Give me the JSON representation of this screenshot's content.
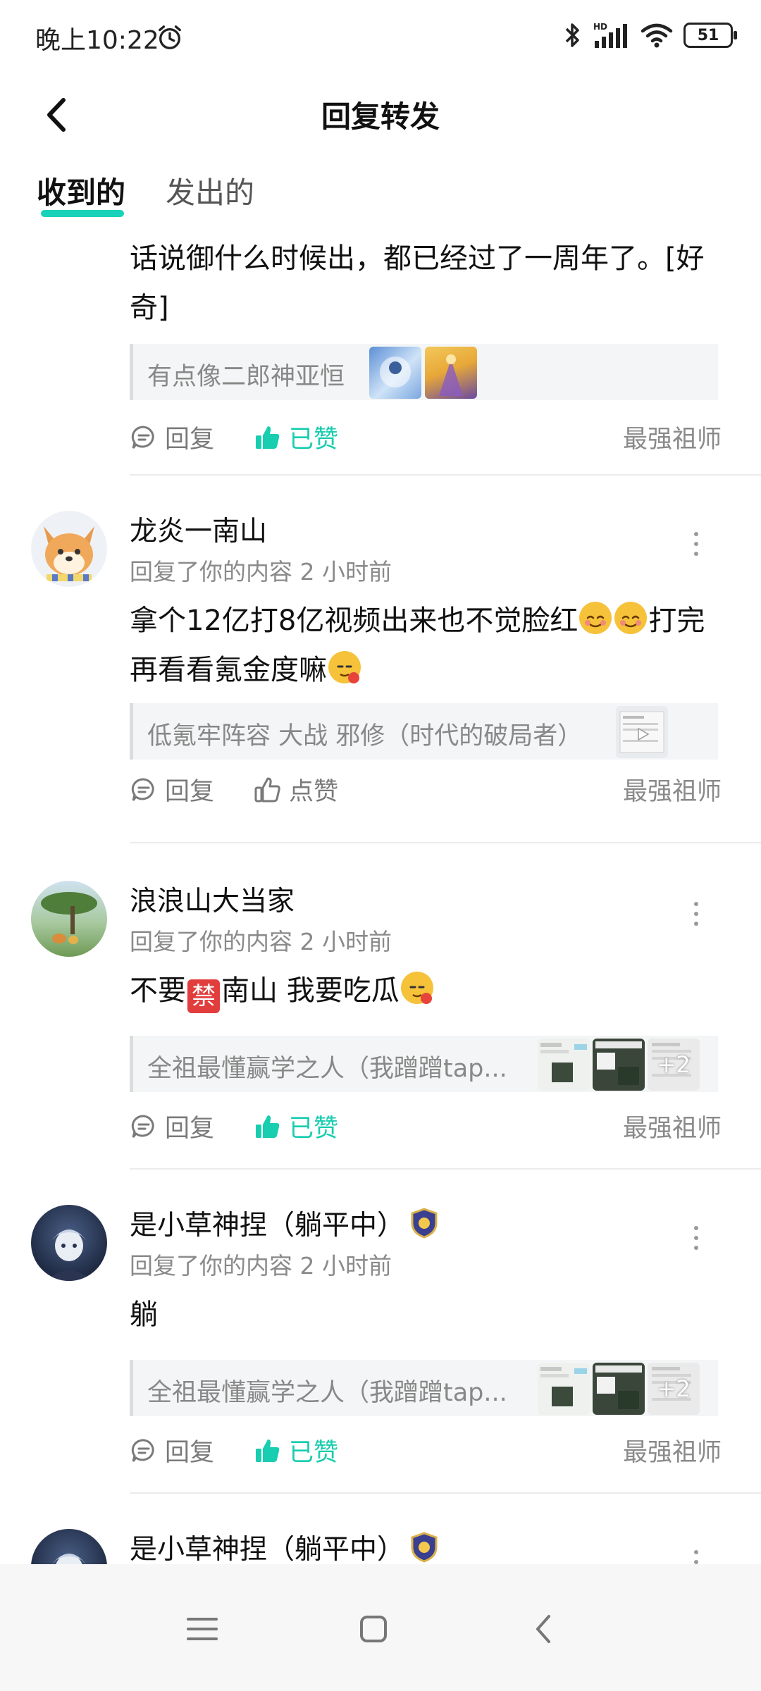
{
  "status_bar": {
    "time": "晚上10:22",
    "battery": "51",
    "network": "HD"
  },
  "header": {
    "title": "回复转发"
  },
  "tabs": [
    {
      "label": "收到的",
      "active": true
    },
    {
      "label": "发出的",
      "active": false
    }
  ],
  "colors": {
    "accent": "#18cdb0"
  },
  "items": [
    {
      "content": "话说御什么时候出，都已经过了一周年了。[好奇]",
      "quote": "有点像二郎神亚恒",
      "reply_label": "回复",
      "like_label": "已赞",
      "liked": true,
      "author": "最强祖师"
    },
    {
      "username": "龙炎一南山",
      "meta": "回复了你的内容 2 小时前",
      "content_a": "拿个12亿打8亿视频出来也不觉脸红",
      "content_b": "打完再看看氪金度嘛",
      "quote": "低氪牢阵容 大战 邪修（时代的破局者）",
      "reply_label": "回复",
      "like_label": "点赞",
      "liked": false,
      "author": "最强祖师"
    },
    {
      "username": "浪浪山大当家",
      "meta": "回复了你的内容 2 小时前",
      "content_a": "不要",
      "ban_char": "禁",
      "content_b": "南山 我要吃瓜",
      "quote": "全祖最懂赢学之人（我蹭蹭tap...",
      "thumb_more": "+2",
      "reply_label": "回复",
      "like_label": "已赞",
      "liked": true,
      "author": "最强祖师"
    },
    {
      "username": "是小草神捏（躺平中）",
      "meta": "回复了你的内容 2 小时前",
      "content": "躺",
      "quote": "全祖最懂赢学之人（我蹭蹭tap...",
      "thumb_more": "+2",
      "reply_label": "回复",
      "like_label": "已赞",
      "liked": true,
      "author": "最强祖师"
    },
    {
      "username": "是小草神捏（躺平中）"
    }
  ]
}
